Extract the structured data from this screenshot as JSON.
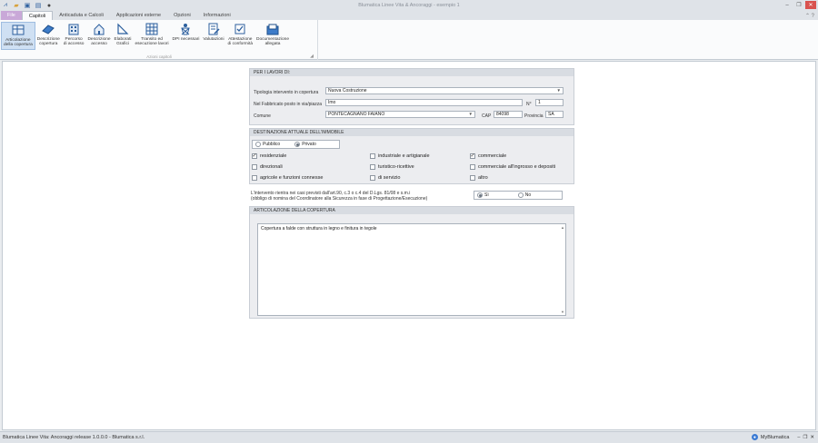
{
  "window": {
    "title": "Blumatica Linee Vita & Ancoraggi - esempio 1",
    "quick_access": [
      "app-icon",
      "open-icon",
      "save-icon",
      "save-as-icon",
      "user-icon"
    ]
  },
  "tabs": [
    {
      "label": "File"
    },
    {
      "label": "Capitoli"
    },
    {
      "label": "Anticaduta e Calcoli"
    },
    {
      "label": "Applicazioni esterne"
    },
    {
      "label": "Opzioni"
    },
    {
      "label": "Informazioni"
    }
  ],
  "ribbon": {
    "group_label": "Azioni capitoli",
    "buttons": [
      {
        "label1": "Articolazione",
        "label2": "della copertura"
      },
      {
        "label1": "Descrizione",
        "label2": "copertura"
      },
      {
        "label1": "Percorso",
        "label2": "di accesso"
      },
      {
        "label1": "Descrizione",
        "label2": "accesso"
      },
      {
        "label1": "Elaborati",
        "label2": "Grafici"
      },
      {
        "label1": "Transito ed",
        "label2": "esecuzione lavori"
      },
      {
        "label1": "DPI necessari",
        "label2": ""
      },
      {
        "label1": "Valutazioni",
        "label2": ""
      },
      {
        "label1": "Attestazione",
        "label2": "di conformità"
      },
      {
        "label1": "Documentazione",
        "label2": "allegata"
      }
    ]
  },
  "lavori": {
    "header": "PER I LAVORI DI:",
    "tipologia_label": "Tipologia intervento in copertura",
    "tipologia_value": "Nuova Costruzione",
    "fabbricato_label": "Nel Fabbricato posto in via/piazza",
    "fabbricato_value": "Imo",
    "numero_label": "N°",
    "numero_value": "1",
    "comune_label": "Comune",
    "comune_value": "PONTECAGNANO FAIANO",
    "cap_label": "CAP",
    "cap_value": "84098",
    "provincia_label": "Provincia",
    "provincia_value": "SA"
  },
  "destinazione": {
    "header": "DESTINAZIONE ATTUALE DELL'IMMOBILE",
    "pubblico": "Pubblico",
    "privato": "Privato",
    "options": [
      {
        "label": "residenziale",
        "checked": true
      },
      {
        "label": "industriale e artigianale",
        "checked": false
      },
      {
        "label": "commerciale",
        "checked": true
      },
      {
        "label": "direzionali",
        "checked": false
      },
      {
        "label": "turistico-ricettive",
        "checked": false
      },
      {
        "label": "commerciale all'ingrosso e depositi",
        "checked": false
      },
      {
        "label": "agricole e funzioni connesse",
        "checked": false
      },
      {
        "label": "di servizio",
        "checked": false
      },
      {
        "label": "altro",
        "checked": false
      }
    ]
  },
  "intervento": {
    "line1": "L'intervento rientra nei casi previsti dall'art.90, c.3 o c.4 del D.Lgs. 81/08 e s.m.i",
    "line2": "(obbligo di nomina del Coordinatore alla Sicurezza in fase di Progettazione/Esecuzione)",
    "si": "Sì",
    "no": "No"
  },
  "articolazione": {
    "header": "ARTICOLAZIONE DELLA COPERTURA",
    "text": "Copertura a falde con struttura in legno e finitura in tegole"
  },
  "status": {
    "left": "Blumatica Linee Vita: Ancoraggi release 1.0.0.0 - Blumatica s.r.l.",
    "right": "MyBlumatica"
  }
}
